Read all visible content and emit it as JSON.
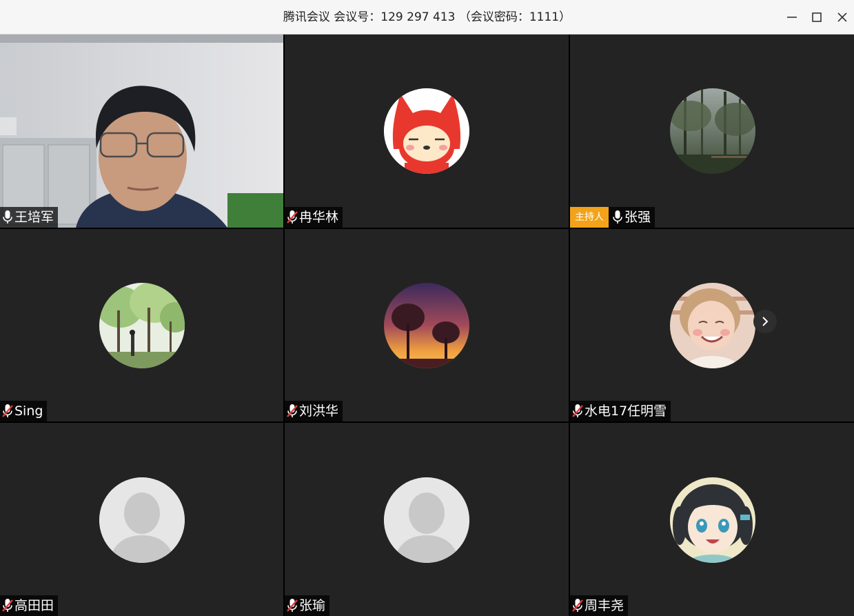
{
  "window": {
    "title": "腾讯会议 会议号：129 297 413 （会议密码：1111）",
    "minimize_icon": "minimize-icon",
    "maximize_icon": "maximize-icon",
    "close_icon": "close-icon"
  },
  "participants": [
    {
      "name": "王培军",
      "mic": "on",
      "video": true
    },
    {
      "name": "冉华林",
      "mic": "muted",
      "avatar": "red-fox-cartoon"
    },
    {
      "name": "张强",
      "mic": "on",
      "host_label": "主持人",
      "avatar": "forest-photo"
    },
    {
      "name": "Sing",
      "mic": "muted",
      "avatar": "park-trees-photo"
    },
    {
      "name": "刘洪华",
      "mic": "muted",
      "avatar": "sunset-trees-art"
    },
    {
      "name": "水电17任明雪",
      "mic": "muted",
      "avatar": "child-photo"
    },
    {
      "name": "高田田",
      "mic": "muted",
      "avatar": "default-person"
    },
    {
      "name": "张瑜",
      "mic": "muted",
      "avatar": "default-person"
    },
    {
      "name": "周丰尧",
      "mic": "muted",
      "avatar": "anime-girl"
    }
  ],
  "colors": {
    "tile_bg": "#232323",
    "host_badge": "#f2a31a",
    "mic_on": "#ffffff",
    "mic_muted": "#e23b3b"
  },
  "icons": {
    "mic_on": "microphone-icon",
    "mic_muted": "microphone-muted-icon",
    "next": "chevron-right-icon"
  }
}
